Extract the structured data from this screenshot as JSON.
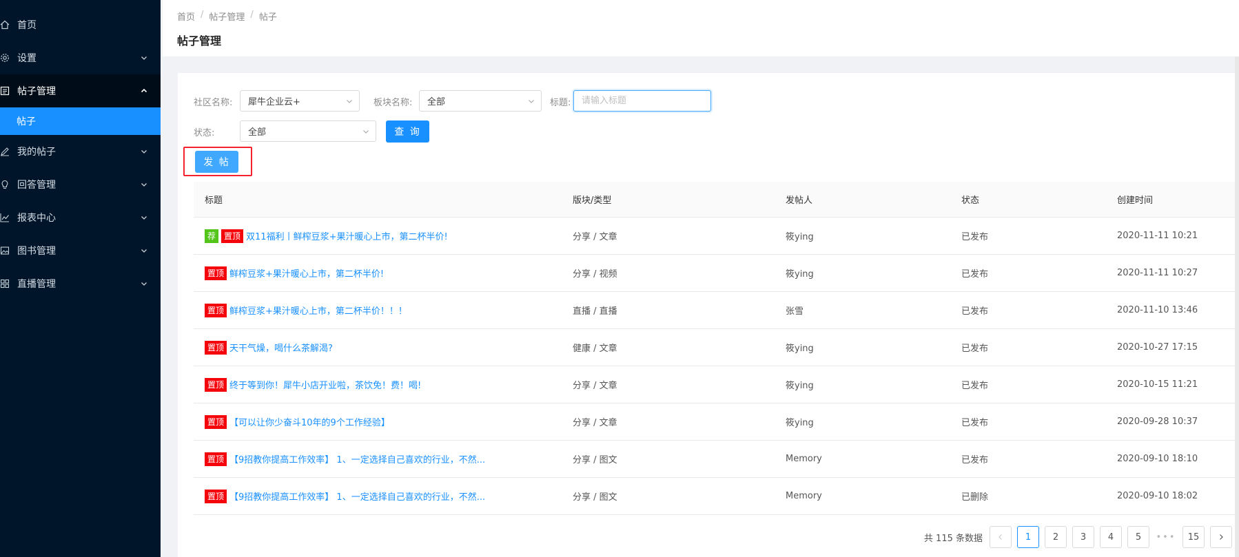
{
  "colors": {
    "sidebar_bg": "#001529",
    "primary": "#1890ff",
    "tag_recommend": "#52c41a",
    "tag_top": "#f5040b",
    "highlight": "#f5222d"
  },
  "sidebar": {
    "items": [
      {
        "label": "首页",
        "icon": "home-icon"
      },
      {
        "label": "设置",
        "icon": "gear-icon"
      },
      {
        "label": "帖子管理",
        "icon": "document-icon"
      },
      {
        "label": "帖子"
      },
      {
        "label": "我的帖子",
        "icon": "edit-icon"
      },
      {
        "label": "回答管理",
        "icon": "bulb-icon"
      },
      {
        "label": "报表中心",
        "icon": "chart-icon"
      },
      {
        "label": "图书管理",
        "icon": "picture-icon"
      },
      {
        "label": "直播管理",
        "icon": "grid-icon"
      }
    ]
  },
  "breadcrumb": [
    "首页",
    "帖子管理",
    "帖子"
  ],
  "page_title": "帖子管理",
  "filters": {
    "community_label": "社区名称:",
    "community_value": "犀牛企业云+",
    "section_label": "板块名称:",
    "section_value": "全部",
    "title_label": "标题:",
    "title_placeholder": "请输入标题",
    "status_label": "状态:",
    "status_value": "全部",
    "query_button": "查 询",
    "post_button": "发 帖"
  },
  "table": {
    "headers": [
      "标题",
      "版块/类型",
      "发帖人",
      "状态",
      "创建时间"
    ],
    "rows": [
      {
        "tags": [
          "荐",
          "置顶"
        ],
        "title": "双11福利丨鲜榨豆浆+果汁暖心上市，第二杯半价!",
        "type": "分享 / 文章",
        "author": "筱ying",
        "status": "已发布",
        "created": "2020-11-11 10:21"
      },
      {
        "tags": [
          "置顶"
        ],
        "title": "鲜榨豆浆+果汁暖心上市，第二杯半价!",
        "type": "分享 / 视频",
        "author": "筱ying",
        "status": "已发布",
        "created": "2020-11-11 10:27"
      },
      {
        "tags": [
          "置顶"
        ],
        "title": "鲜榨豆浆+果汁暖心上市，第二杯半价！！！",
        "type": "直播 / 直播",
        "author": "张雪",
        "status": "已发布",
        "created": "2020-11-10 13:46"
      },
      {
        "tags": [
          "置顶"
        ],
        "title": "天干气燥，喝什么茶解渴?",
        "type": "健康 / 文章",
        "author": "筱ying",
        "status": "已发布",
        "created": "2020-10-27 17:15"
      },
      {
        "tags": [
          "置顶"
        ],
        "title": "终于等到你！犀牛小店开业啦，茶饮免！费！喝!",
        "type": "分享 / 文章",
        "author": "筱ying",
        "status": "已发布",
        "created": "2020-10-15 11:21"
      },
      {
        "tags": [
          "置顶"
        ],
        "title": "【可以让你少奋斗10年的9个工作经验】",
        "type": "分享 / 文章",
        "author": "筱ying",
        "status": "已发布",
        "created": "2020-09-28 10:37"
      },
      {
        "tags": [
          "置顶"
        ],
        "title": "【9招教你提高工作效率】 1、一定选择自己喜欢的行业，不然...",
        "type": "分享 / 图文",
        "author": "Memory",
        "status": "已发布",
        "created": "2020-09-10 18:10"
      },
      {
        "tags": [
          "置顶"
        ],
        "title": "【9招教你提高工作效率】 1、一定选择自己喜欢的行业，不然...",
        "type": "分享 / 图文",
        "author": "Memory",
        "status": "已删除",
        "created": "2020-09-10 18:02"
      }
    ]
  },
  "pagination": {
    "total_text": "共 115 条数据",
    "pages": [
      "1",
      "2",
      "3",
      "4",
      "5",
      "•••",
      "15"
    ],
    "current": "1"
  }
}
